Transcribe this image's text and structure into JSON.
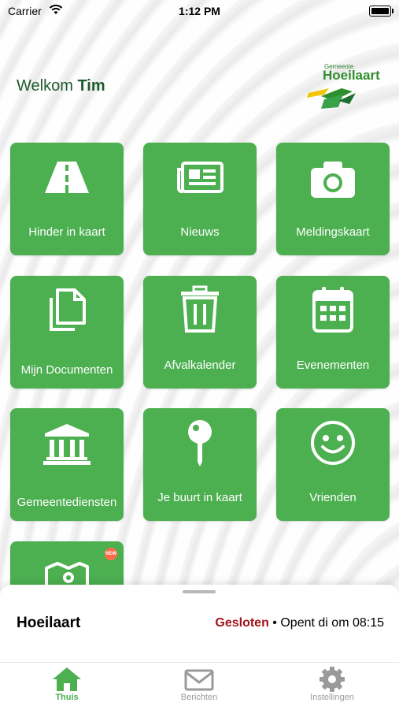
{
  "status_bar": {
    "carrier": "Carrier",
    "time": "1:12 PM"
  },
  "header": {
    "welcome_prefix": "Welkom",
    "user_name": "Tim"
  },
  "logo": {
    "small_text": "Gemeente",
    "big_text": "Hoeilaart"
  },
  "tiles": [
    {
      "label": "Hinder in kaart",
      "icon": "road-icon"
    },
    {
      "label": "Nieuws",
      "icon": "newspaper-icon"
    },
    {
      "label": "Meldingskaart",
      "icon": "camera-icon"
    },
    {
      "label": "Mijn Documenten",
      "icon": "documents-icon"
    },
    {
      "label": "Afvalkalender",
      "icon": "trash-icon"
    },
    {
      "label": "Evenementen",
      "icon": "calendar-icon"
    },
    {
      "label": "Gemeentediensten",
      "icon": "building-icon"
    },
    {
      "label": "Je buurt in kaart",
      "icon": "pin-icon"
    },
    {
      "label": "Vrienden",
      "icon": "smiley-icon"
    },
    {
      "label": "",
      "icon": "map-icon"
    }
  ],
  "sheet": {
    "place": "Hoeilaart",
    "state": "Gesloten",
    "separator": "•",
    "opens": "Opent di om 08:15"
  },
  "tabbar": [
    {
      "label": "Thuis",
      "icon": "home-icon",
      "active": true
    },
    {
      "label": "Berichten",
      "icon": "mail-icon",
      "active": false
    },
    {
      "label": "Instellingen",
      "icon": "gear-icon",
      "active": false
    }
  ],
  "colors": {
    "tile": "#4caf50",
    "closed": "#a3131a",
    "accent": "#4caf50"
  }
}
